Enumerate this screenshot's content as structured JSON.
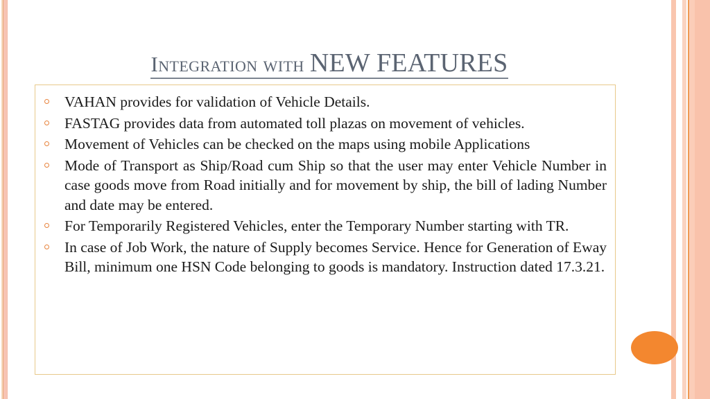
{
  "slide": {
    "title": {
      "lead": "Integration with ",
      "emphasis": "NEW FEATURES"
    },
    "bullets": [
      "VAHAN provides for validation of Vehicle Details.",
      "FASTAG provides data from automated toll plazas on movement of vehicles.",
      "Movement of Vehicles can be checked on the maps using mobile Applications",
      "Mode of Transport as Ship/Road cum Ship so that the user may enter Vehicle Number in case goods move from Road initially and for movement by ship, the bill of lading Number and date may be entered.",
      "For Temporarily Registered Vehicles, enter the Temporary Number starting with TR.",
      "In case of Job Work, the nature of Supply becomes Service. Hence for Generation of Eway Bill, minimum one HSN Code belonging to goods is mandatory. Instruction dated 17.3.21."
    ],
    "decorations": {
      "bullet_marker_color": "#e8833c",
      "title_color": "#5b6472",
      "box_border_color": "#e8c98a",
      "ellipse_color": "#f3872f",
      "stripe_color": "#f9c2ab"
    }
  }
}
